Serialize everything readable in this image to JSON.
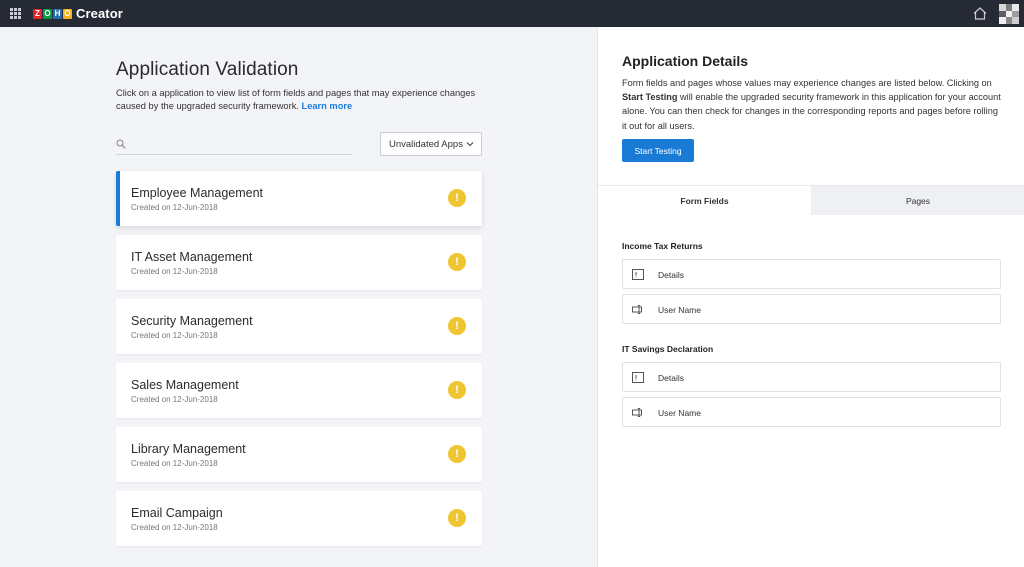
{
  "topbar": {
    "logo_letters": [
      "Z",
      "O",
      "H",
      "O"
    ],
    "logo_colors": [
      "#e42527",
      "#089949",
      "#226db4",
      "#f9b21d"
    ],
    "product_name": "Creator",
    "icons": [
      "apps-grid-icon",
      "home-icon",
      "avatar"
    ]
  },
  "left": {
    "title": "Application Validation",
    "description": "Click on a application to view list of form fields and pages that may experience changes caused by the upgraded security framework.",
    "learn_more": "Learn more",
    "search": {
      "value": "",
      "placeholder": ""
    },
    "filter": {
      "selected": "Unvalidated Apps"
    },
    "apps": [
      {
        "name": "Employee Management",
        "created": "Created on 12-Jun-2018",
        "active": true
      },
      {
        "name": "IT Asset Management",
        "created": "Created on 12-Jun-2018",
        "active": false
      },
      {
        "name": "Security Management",
        "created": "Created on 12-Jun-2018",
        "active": false
      },
      {
        "name": "Sales Management",
        "created": "Created on 12-Jun-2018",
        "active": false
      },
      {
        "name": "Library Management",
        "created": "Created on 12-Jun-2018",
        "active": false
      },
      {
        "name": "Email Campaign",
        "created": "Created on 12-Jun-2018",
        "active": false
      }
    ],
    "warning_glyph": "!"
  },
  "right": {
    "title": "Application Details",
    "description_pre": "Form fields and pages whose values may experience changes are listed below. Clicking on ",
    "description_bold": "Start Testing",
    "description_post": " will enable the upgraded security framework in this application for your account alone. You can then check for changes in the corresponding reports and pages before rolling it out for all users.",
    "start_button": "Start Testing",
    "tabs": [
      {
        "label": "Form Fields",
        "active": true
      },
      {
        "label": "Pages",
        "active": false
      }
    ],
    "forms": [
      {
        "name": "Income Tax Returns",
        "fields": [
          {
            "label": "Details",
            "icon": "rich-text-field-icon"
          },
          {
            "label": "User Name",
            "icon": "single-line-field-icon"
          }
        ]
      },
      {
        "name": "IT Savings Declaration",
        "fields": [
          {
            "label": "Details",
            "icon": "rich-text-field-icon"
          },
          {
            "label": "User Name",
            "icon": "single-line-field-icon"
          }
        ]
      }
    ]
  },
  "colors": {
    "topbar": "#262a35",
    "accent": "#1a7bd6",
    "warning": "#efc632",
    "page_bg": "#f3f4f8"
  }
}
